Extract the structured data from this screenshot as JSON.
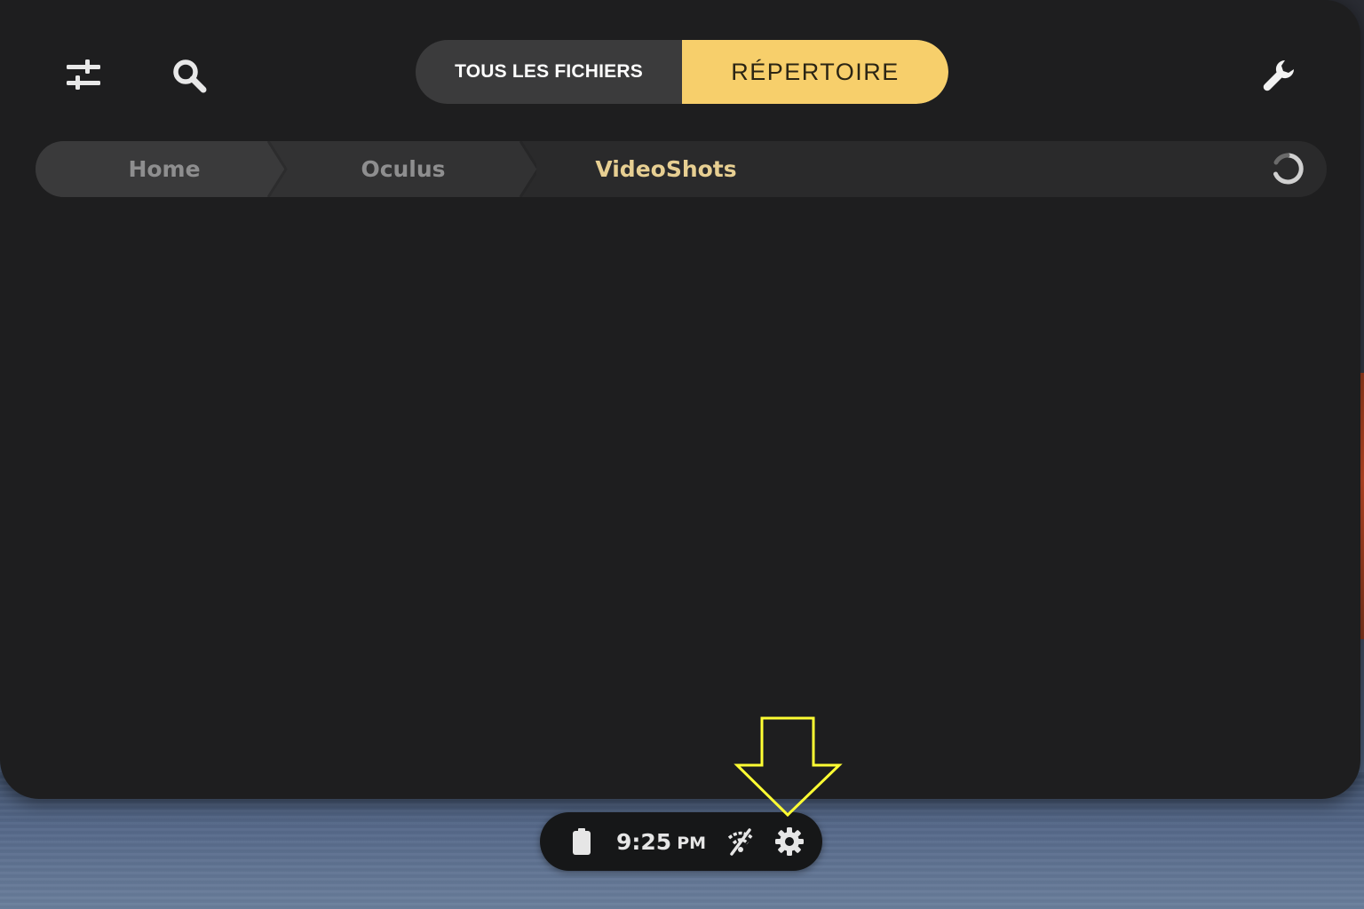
{
  "toolbar": {
    "filter_icon": "sliders-icon",
    "search_icon": "search-icon",
    "settings_icon": "wrench-icon"
  },
  "tabs": [
    {
      "label": "TOUS LES FICHIERS",
      "active": false
    },
    {
      "label": "RÉPERTOIRE",
      "active": true
    }
  ],
  "breadcrumb": {
    "items": [
      {
        "label": "Home"
      },
      {
        "label": "Oculus"
      },
      {
        "label": "VideoShots",
        "current": true
      }
    ],
    "refresh_icon": "refresh-icon"
  },
  "status_bar": {
    "battery_icon": "battery-icon",
    "time": "9:25",
    "ampm": "PM",
    "wifi_icon": "wifi-off-icon",
    "settings_icon": "gear-icon"
  },
  "colors": {
    "accent": "#f7cf6b",
    "current_crumb": "#e7cf92",
    "panel": "#1e1e1f",
    "annotation": "#ffff33"
  }
}
